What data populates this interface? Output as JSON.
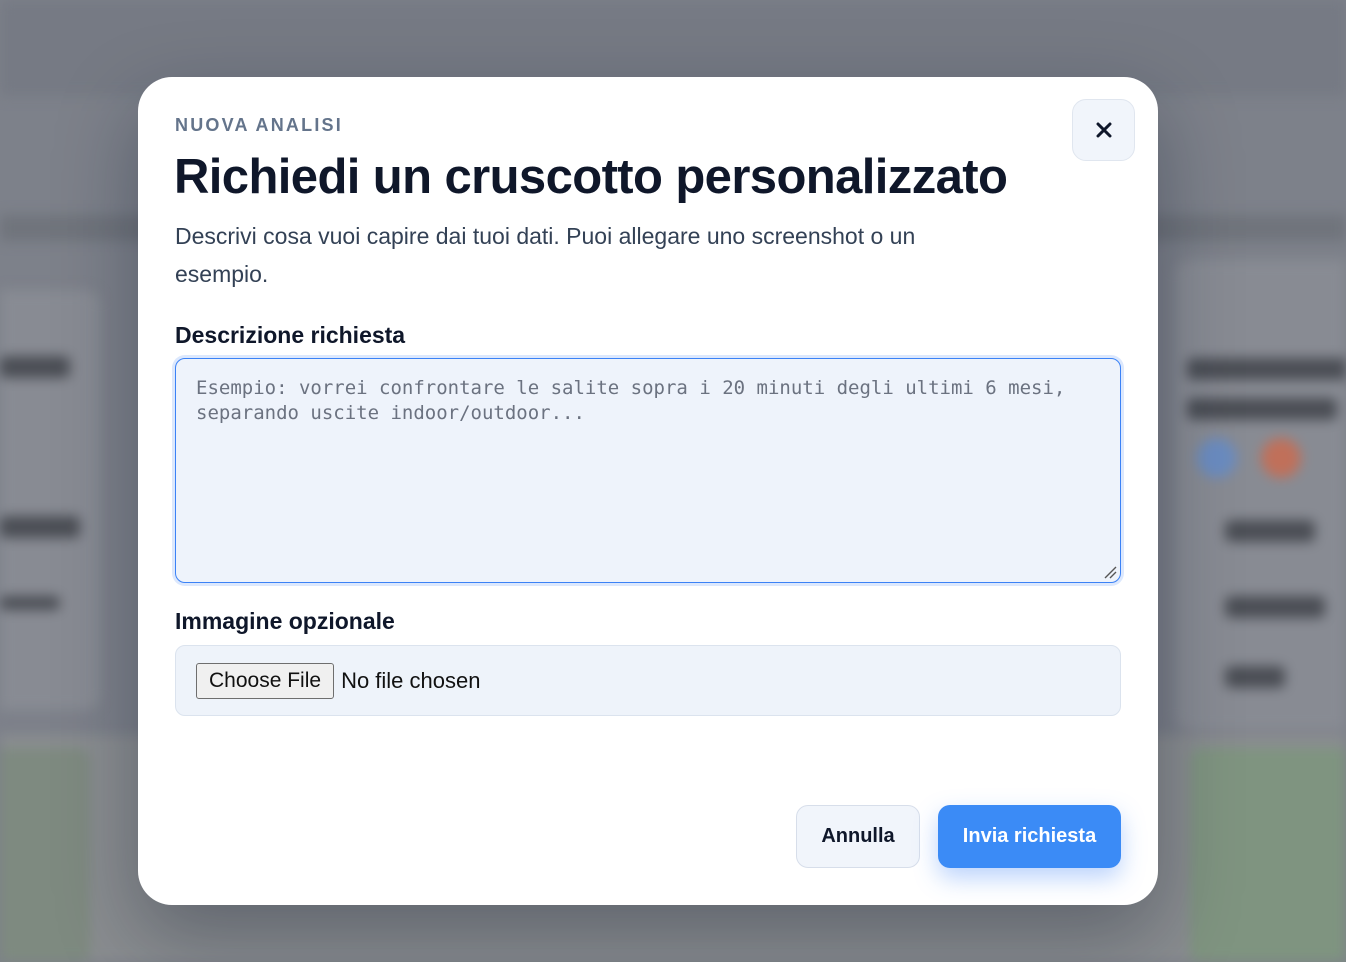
{
  "modal": {
    "eyebrow": "NUOVA ANALISI",
    "title": "Richiedi un cruscotto personalizzato",
    "subtitle": "Descrivi cosa vuoi capire dai tuoi dati. Puoi allegare uno screenshot o un esempio.",
    "close_icon": "close-icon"
  },
  "form": {
    "description": {
      "label": "Descrizione richiesta",
      "value": "",
      "placeholder": "Esempio: vorrei confrontare le salite sopra i 20 minuti degli ultimi 6 mesi, separando uscite indoor/outdoor..."
    },
    "image": {
      "label": "Immagine opzionale",
      "button_label": "Choose File",
      "status": "No file chosen"
    }
  },
  "actions": {
    "cancel_label": "Annulla",
    "submit_label": "Invia richiesta"
  },
  "colors": {
    "accent": "#3b8bf6",
    "overlay": "#7d818a",
    "title": "#0f172a",
    "muted": "#64748b"
  }
}
